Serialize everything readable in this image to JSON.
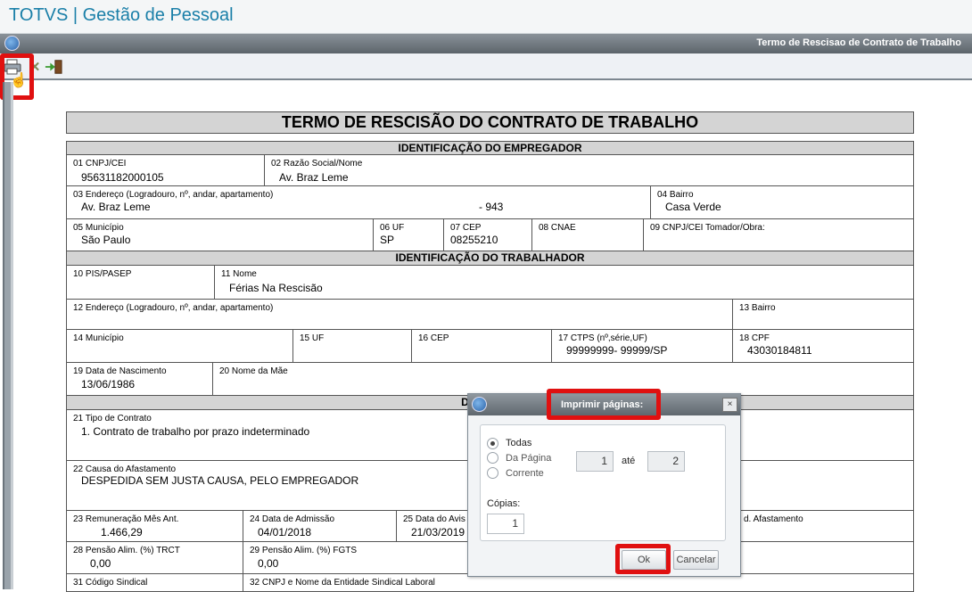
{
  "app": {
    "title": "TOTVS | Gestão de Pessoal"
  },
  "window": {
    "title": "Termo de Rescisao de Contrato de Trabalho"
  },
  "toolbar": {
    "print_icon": "printer-icon",
    "cancel_icon": "cancel-x-icon",
    "exit_icon": "exit-door-icon"
  },
  "colors": {
    "highlight": "#e01010",
    "app_title": "#1a7fa8",
    "section_bg": "#d4d4d4"
  },
  "doc": {
    "title": "TERMO DE RESCISÃO DO CONTRATO DE TRABALHO",
    "sec_employer": "IDENTIFICAÇÃO DO EMPREGADOR",
    "f01_label": "01 CNPJ/CEI",
    "f01_value": "95631182000105",
    "f02_label": "02 Razão Social/Nome",
    "f02_value": "Av. Braz Leme",
    "f03_label": "03 Endereço (Logradouro, nº, andar, apartamento)",
    "f03_value": "Av. Braz Leme",
    "f03_number": "- 943",
    "f04_label": "04 Bairro",
    "f04_value": "Casa Verde",
    "f05_label": "05 Município",
    "f05_value": "São Paulo",
    "f06_label": "06 UF",
    "f06_value": "SP",
    "f07_label": "07 CEP",
    "f07_value": "08255210",
    "f08_label": "08 CNAE",
    "f09_label": "09 CNPJ/CEI Tomador/Obra:",
    "sec_worker": "IDENTIFICAÇÃO DO TRABALHADOR",
    "f10_label": "10 PIS/PASEP",
    "f11_label": "11 Nome",
    "f11_value": "Férias Na Rescisão",
    "f12_label": "12 Endereço (Logradouro, nº, andar, apartamento)",
    "f13_label": "13 Bairro",
    "f14_label": "14 Município",
    "f15_label": "15 UF",
    "f16_label": "16 CEP",
    "f17_label": "17 CTPS (nº,série,UF)",
    "f17_value": "99999999- 99999/SP",
    "f18_label": "18 CPF",
    "f18_value": "43030184811",
    "f19_label": "19 Data de Nascimento",
    "f19_value": "13/06/1986",
    "f20_label": "20 Nome da Mãe",
    "sec_contract": "DADOS DO",
    "f21_label": "21 Tipo de Contrato",
    "f21_value": "1. Contrato de trabalho por prazo indeterminado",
    "f22_label": "22 Causa do Afastamento",
    "f22_value": "DESPEDIDA SEM JUSTA CAUSA, PELO EMPREGADOR",
    "f23_label": "23 Remuneração Mês Ant.",
    "f23_value": "1.466,29",
    "f24_label": "24 Data de Admissão",
    "f24_value": "04/01/2018",
    "f25_label": "25 Data do Avis",
    "f25_value": "21/03/2019",
    "f26_label": "d. Afastamento",
    "f28_label": "28 Pensão Alim. (%) TRCT",
    "f28_value": "0,00",
    "f29_label": "29 Pensão Alim. (%) FGTS",
    "f29_value": "0,00",
    "f31_label": "31 Código Sindical",
    "f32_label": "32 CNPJ e Nome da Entidade Sindical Laboral"
  },
  "dialog": {
    "title": "Imprimir páginas:",
    "close_label": "×",
    "opt_all": "Todas",
    "opt_from_page": "Da Página",
    "opt_current": "Corrente",
    "from_value": "1",
    "to_label": "até",
    "to_value": "2",
    "copies_label": "Cópias:",
    "copies_value": "1",
    "ok_label": "Ok",
    "cancel_label": "Cancelar",
    "selected_option": "Todas"
  }
}
